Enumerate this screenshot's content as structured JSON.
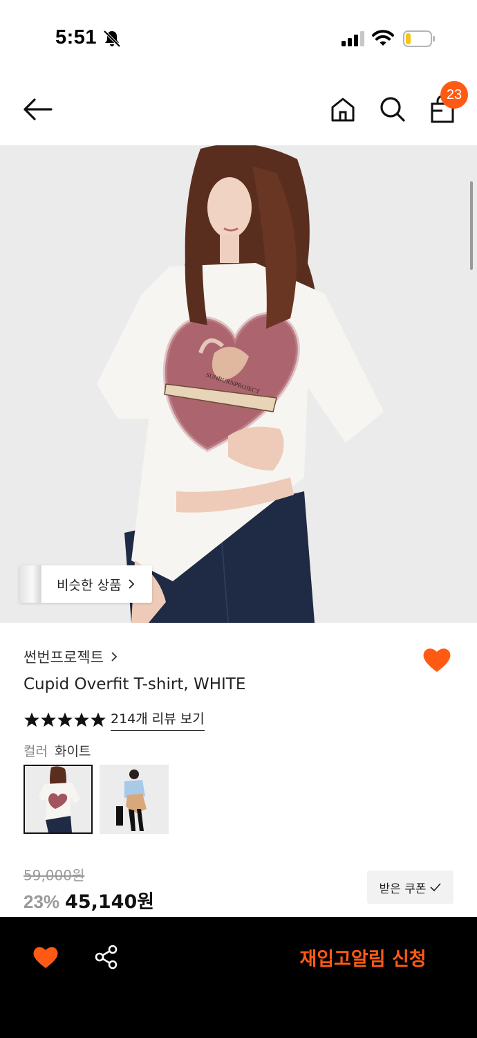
{
  "status_bar": {
    "time": "5:51",
    "icons": [
      "bell-off-icon",
      "cellular-signal-icon",
      "wifi-icon",
      "battery-low-icon"
    ],
    "battery_color": "#f5c518"
  },
  "header": {
    "icons": [
      "back-arrow-icon",
      "home-icon",
      "search-icon",
      "shopping-bag-icon"
    ],
    "cart_count": "23",
    "badge_color": "#ff5a14"
  },
  "product_image": {
    "print_text": "SUNBURNPROJECT",
    "similar_button_label": "비슷한 상품"
  },
  "product": {
    "brand": "썬번프로젝트",
    "name": "Cupid Overfit T-shirt, WHITE",
    "rating_stars": 5,
    "review_link": "214개 리뷰 보기",
    "color_label": "컬러",
    "color_value": "화이트",
    "original_price": "59,000원",
    "discount_rate": "23%",
    "sale_price": "45,140원",
    "coupon_label": "받은 쿠폰"
  },
  "bottom_bar": {
    "restock_label": "재입고알림 신청",
    "accent_color": "#ff5a14"
  }
}
